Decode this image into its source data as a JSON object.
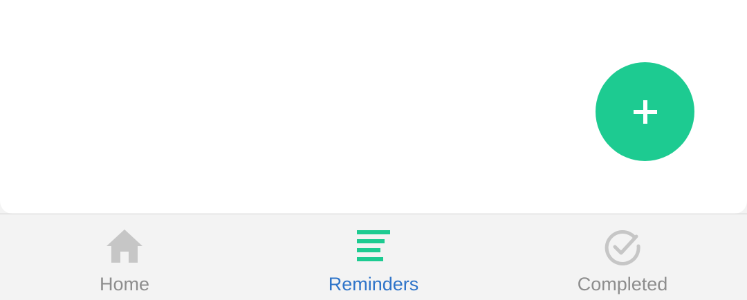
{
  "fab": {
    "icon": "plus-icon",
    "color": "#1dcb91"
  },
  "bottom_nav": {
    "items": [
      {
        "label": "Home",
        "icon": "home-icon",
        "active": false
      },
      {
        "label": "Reminders",
        "icon": "list-icon",
        "active": true
      },
      {
        "label": "Completed",
        "icon": "check-circle-icon",
        "active": false
      }
    ],
    "active_label_color": "#2e74c9",
    "inactive_label_color": "#8d8d8d",
    "active_icon_color": "#1dcb91",
    "inactive_icon_color": "#c6c6c6"
  }
}
